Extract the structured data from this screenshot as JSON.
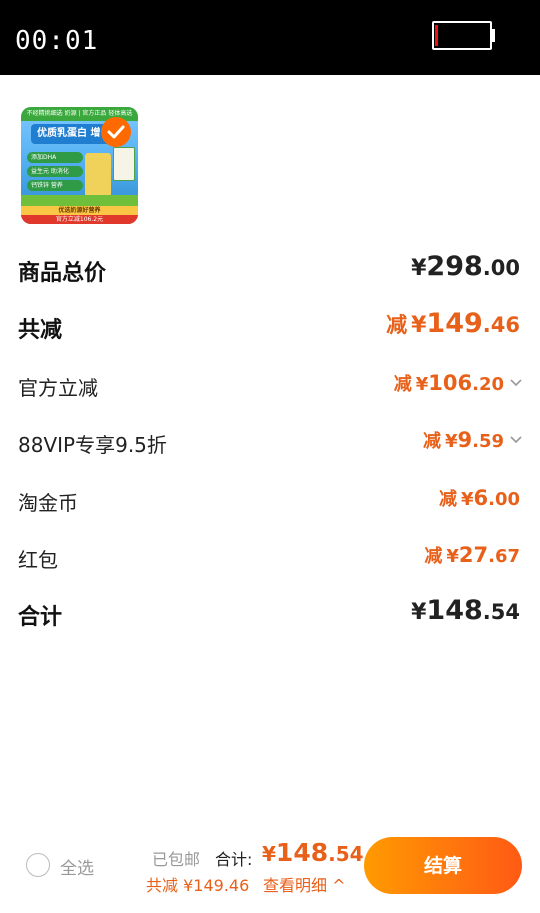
{
  "status_bar": {
    "time": "00:01"
  },
  "product": {
    "thumb_texts": {
      "top": "不经精挑细选 奶源 | 官方正品 轻体高选",
      "headline": "优质乳蛋白 增",
      "pill1": "添加DHA",
      "pill2": "益生元 助消化",
      "pill3": "钙铁锌 营养",
      "promo1": "优选奶源好营养",
      "promo2": "官方立减106.2元"
    },
    "selected": true
  },
  "price_rows": [
    {
      "label": "商品总价",
      "prefix": "",
      "yen": "¥",
      "int": "298",
      "dec": ".00",
      "style": "dark",
      "chevron": false
    },
    {
      "label": "共减",
      "prefix": "减",
      "yen": "¥",
      "int": "149",
      "dec": ".46",
      "style": "orange",
      "chevron": false
    },
    {
      "label": "官方立减",
      "prefix": "减",
      "yen": "¥",
      "int": "106",
      "dec": ".20",
      "style": "orange",
      "chevron": true
    },
    {
      "label": "88VIP专享9.5折",
      "prefix": "减",
      "yen": "¥",
      "int": "9",
      "dec": ".59",
      "style": "orange",
      "chevron": true
    },
    {
      "label": "淘金币",
      "prefix": "减",
      "yen": "¥",
      "int": "6",
      "dec": ".00",
      "style": "orange",
      "chevron": false
    },
    {
      "label": "红包",
      "prefix": "减",
      "yen": "¥",
      "int": "27",
      "dec": ".67",
      "style": "orange",
      "chevron": false
    },
    {
      "label": "合计",
      "prefix": "",
      "yen": "¥",
      "int": "148",
      "dec": ".54",
      "style": "dark",
      "chevron": false
    }
  ],
  "bottom_bar": {
    "select_all": "全选",
    "free_shipping": "已包邮",
    "total_label": "合计:",
    "total_yen": "¥",
    "total_int": "148",
    "total_dec": ".54",
    "saved_text": "共减 ¥149.46",
    "detail_text": "查看明细 ^",
    "checkout_label": "结算"
  },
  "colors": {
    "accent": "#e8611a",
    "checkout_gradient_start": "#ff9a00",
    "checkout_gradient_end": "#ff5a14"
  }
}
